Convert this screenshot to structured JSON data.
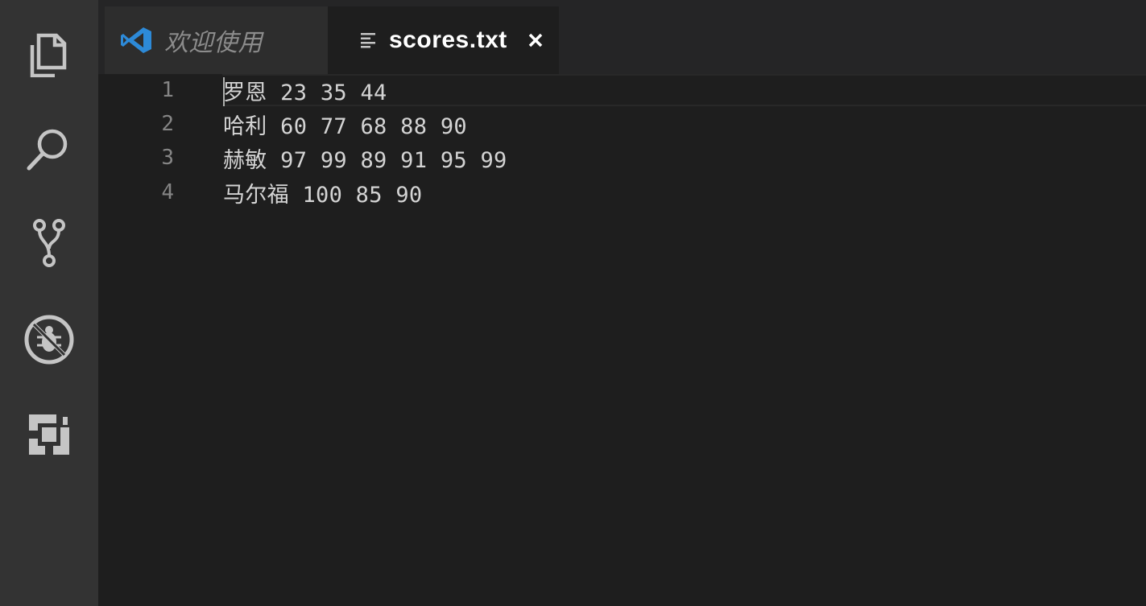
{
  "activity_bar": {
    "items": [
      {
        "icon": "files-icon"
      },
      {
        "icon": "search-icon"
      },
      {
        "icon": "source-control-icon"
      },
      {
        "icon": "debug-icon"
      },
      {
        "icon": "extensions-icon"
      }
    ]
  },
  "tabs": [
    {
      "title": "欢迎使用",
      "icon": "vscode-logo-icon",
      "active": false
    },
    {
      "title": "scores.txt",
      "icon": "text-file-icon",
      "active": true,
      "close_symbol": "×"
    }
  ],
  "editor": {
    "lines": [
      {
        "number": "1",
        "text": "罗恩 23 35 44"
      },
      {
        "number": "2",
        "text": "哈利 60 77 68 88 90"
      },
      {
        "number": "3",
        "text": "赫敏 97 99 89 91 95 99"
      },
      {
        "number": "4",
        "text": "马尔福 100 85 90"
      }
    ]
  },
  "colors": {
    "activity_bar": "#333333",
    "tab_bar": "#252526",
    "editor_bg": "#1e1e1e",
    "vscode_blue": "#2d8ad8",
    "icon_gray": "#c5c5c5"
  }
}
